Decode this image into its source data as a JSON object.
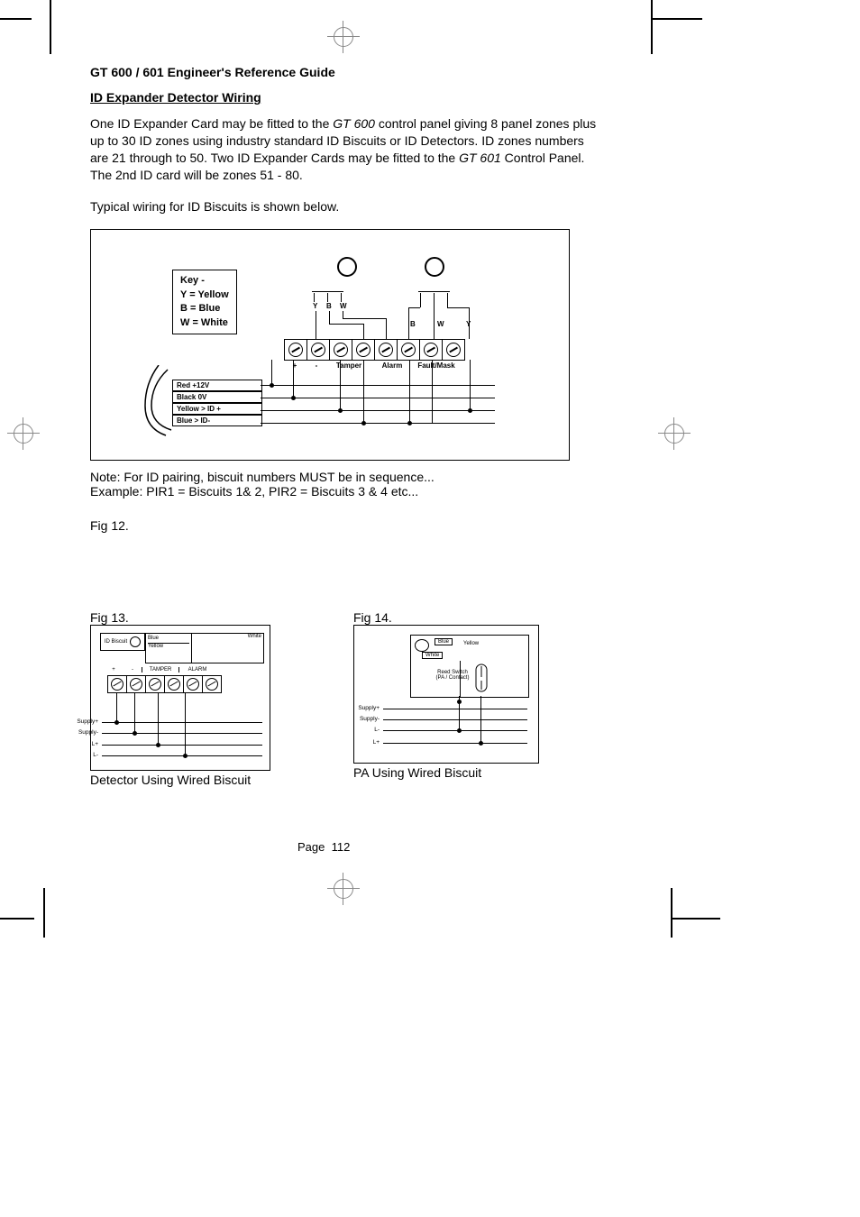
{
  "header": "GT 600 / 601 Engineer's Reference Guide",
  "section_title": "ID Expander Detector Wiring",
  "para1_a": "One ID Expander Card may be fitted to the ",
  "para1_it1": "GT 600",
  "para1_b": " control panel giving 8 panel zones plus up to 30 ID zones using industry standard ID Biscuits or ID Detectors. ID zones numbers are 21 through to 50. Two ID Expander Cards may be fitted to the ",
  "para1_it2": "GT 601",
  "para1_c": " Control Panel. The 2nd ID card will be zones 51 - 80.",
  "para2": "Typical wiring for ID Biscuits is shown below.",
  "fig12": {
    "key_title": "Key -",
    "key_y": "Y = Yellow",
    "key_b": "B = Blue",
    "key_w": "W = White",
    "top_y": "Y",
    "top_b": "B",
    "top_w": "W",
    "top2_b": "B",
    "top2_w": "W",
    "top2_y": "Y",
    "t_plus": "+",
    "t_minus": "-",
    "t_tamper": "Tamper",
    "t_alarm": "Alarm",
    "t_fault": "Fault/Mask",
    "w_red": "Red +12V",
    "w_black": "Black 0V",
    "w_yellow": "Yellow > ID +",
    "w_blue": "Blue > ID-"
  },
  "note1": "Note: For ID pairing, biscuit numbers MUST be in sequence...",
  "note2": "Example: PIR1 = Biscuits 1& 2, PIR2 = Biscuits 3 & 4 etc...",
  "fig12_cap": "Fig 12.",
  "fig13": {
    "cap": "Fig 13.",
    "id_biscuit": "ID Biscuit",
    "blue": "Blue",
    "yellow": "Yellow",
    "white": "White",
    "plus": "+",
    "minus": "-",
    "tamper": "TAMPER",
    "alarm": "ALARM",
    "supply_p": "Supply+",
    "supply_m": "Supply-",
    "lp": "L+",
    "lm": "L-",
    "caption": "Detector Using Wired Biscuit"
  },
  "fig14": {
    "cap": "Fig 14.",
    "blue": "Blue",
    "yellow": "Yellow",
    "white": "White",
    "reed": "Reed Switch\n(PA / Contact)",
    "supply_p": "Supply+",
    "supply_m": "Supply-",
    "lm": "L-",
    "lp": "L+",
    "caption": "PA Using Wired Biscuit"
  },
  "page_label": "Page",
  "page_num": "112"
}
